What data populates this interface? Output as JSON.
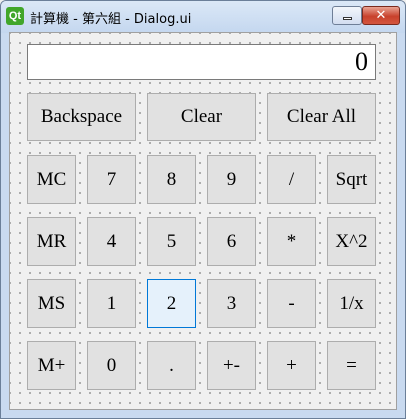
{
  "window": {
    "app_icon_label": "Qt",
    "title": "計算機 - 第六組 - Dialog.ui",
    "close_glyph": "✕"
  },
  "display": {
    "value": "0"
  },
  "buttons": {
    "backspace": "Backspace",
    "clear": "Clear",
    "clear_all": "Clear All",
    "mc": "MC",
    "mr": "MR",
    "ms": "MS",
    "mplus": "M+",
    "d7": "7",
    "d8": "8",
    "d9": "9",
    "d4": "4",
    "d5": "5",
    "d6": "6",
    "d1": "1",
    "d2": "2",
    "d3": "3",
    "d0": "0",
    "dot": ".",
    "plusminus": "+-",
    "divide": "/",
    "multiply": "*",
    "minus": "-",
    "plus": "+",
    "sqrt": "Sqrt",
    "square": "X^2",
    "reciprocal": "1/x",
    "equals": "="
  },
  "focused_button": "2"
}
